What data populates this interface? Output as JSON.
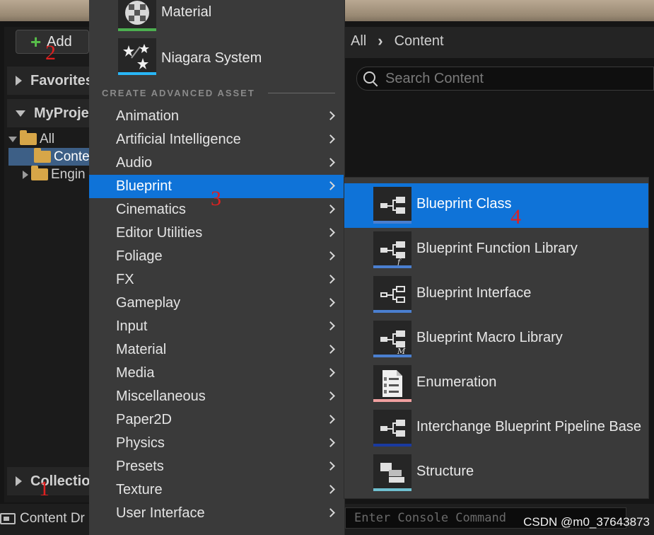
{
  "toolbar": {
    "add_label": "Add"
  },
  "breadcrumb": {
    "root": "All",
    "current": "Content"
  },
  "search": {
    "placeholder": "Search Content"
  },
  "sidebar": {
    "favorites": "Favorites",
    "project": "MyProjec",
    "collections": "Collection",
    "tree": [
      {
        "label": "All"
      },
      {
        "label": "Conte"
      },
      {
        "label": "Engin"
      }
    ]
  },
  "menu": {
    "assets": [
      {
        "label": "Material",
        "bar_color": "#4caf50",
        "icon": "material-icon"
      },
      {
        "label": "Niagara System",
        "bar_color": "#29b6f6",
        "icon": "niagara-icon"
      }
    ],
    "section_title": "CREATE ADVANCED ASSET",
    "categories": [
      "Animation",
      "Artificial Intelligence",
      "Audio",
      "Blueprint",
      "Cinematics",
      "Editor Utilities",
      "Foliage",
      "FX",
      "Gameplay",
      "Input",
      "Material",
      "Media",
      "Miscellaneous",
      "Paper2D",
      "Physics",
      "Presets",
      "Texture",
      "User Interface"
    ],
    "active_category": "Blueprint"
  },
  "submenu": {
    "items": [
      {
        "label": "Blueprint Class",
        "bar_color": "#4a7fd0",
        "icon": "blueprint-class-icon"
      },
      {
        "label": "Blueprint Function Library",
        "bar_color": "#4a7fd0",
        "icon": "blueprint-function-library-icon"
      },
      {
        "label": "Blueprint Interface",
        "bar_color": "#4a7fd0",
        "icon": "blueprint-interface-icon"
      },
      {
        "label": "Blueprint Macro Library",
        "bar_color": "#4a7fd0",
        "icon": "blueprint-macro-library-icon"
      },
      {
        "label": "Enumeration",
        "bar_color": "#f0a0a0",
        "icon": "enumeration-icon"
      },
      {
        "label": "Interchange Blueprint Pipeline Base",
        "bar_color": "#1a3aa0",
        "icon": "interchange-pipeline-icon"
      },
      {
        "label": "Structure",
        "bar_color": "#6fc0d0",
        "icon": "structure-icon"
      }
    ],
    "active_item": "Blueprint Class"
  },
  "bottom": {
    "content_drawer": "Content Dr",
    "console_placeholder": "Enter Console Command"
  },
  "watermark": "CSDN @m0_37643873",
  "annotations": [
    "1",
    "2",
    "3",
    "4"
  ],
  "colors": {
    "accent": "#0f73d8",
    "menu_bg": "#3a3a3a"
  }
}
